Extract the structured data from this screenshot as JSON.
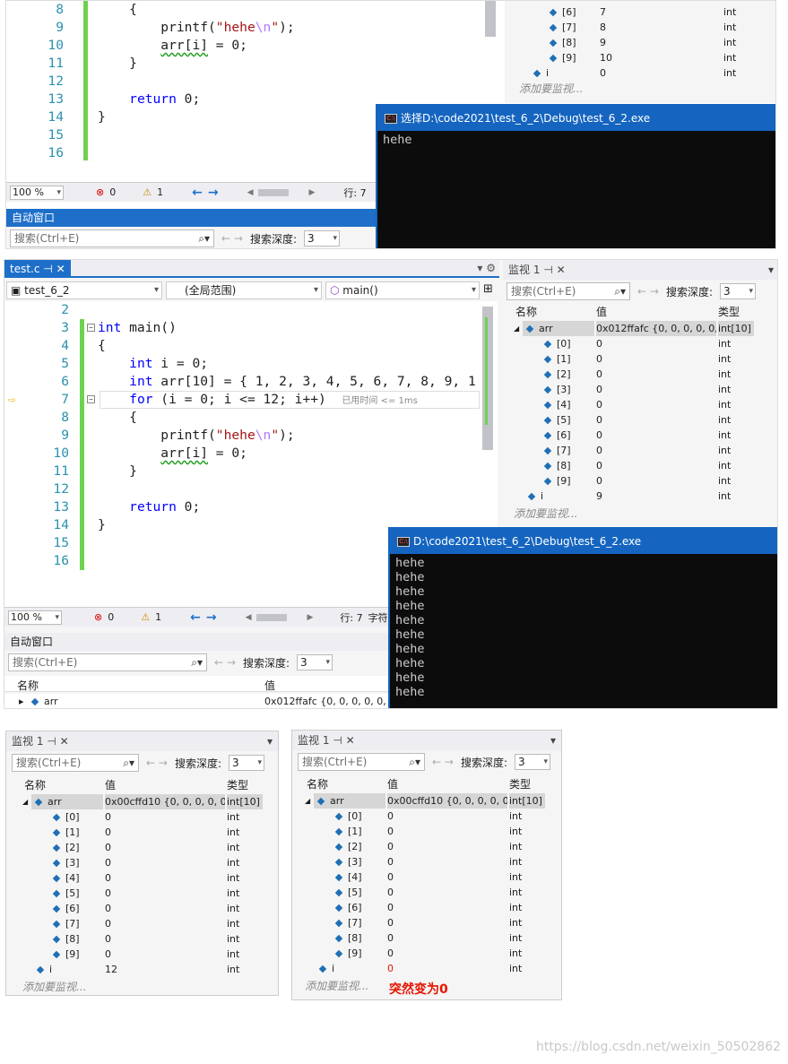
{
  "top": {
    "lines": [
      {
        "n": "8",
        "t": "{"
      },
      {
        "n": "9",
        "t": "printf(\"hehe\\n\");"
      },
      {
        "n": "10",
        "t": "arr[i] = 0;"
      },
      {
        "n": "11",
        "t": "}"
      },
      {
        "n": "12",
        "t": ""
      },
      {
        "n": "13",
        "t": "return 0;"
      },
      {
        "n": "14",
        "t": "}"
      },
      {
        "n": "15",
        "t": ""
      },
      {
        "n": "16",
        "t": ""
      }
    ],
    "status": {
      "zoom": "100 %",
      "errors": "0",
      "warnings": "1",
      "row": "行: 7"
    },
    "autos_title": "自动窗口",
    "search_placeholder": "搜索(Ctrl+E)",
    "depth_label": "搜索深度:",
    "depth_value": "3",
    "watch_rows": [
      {
        "name": "[6]",
        "value": "7",
        "type": "int"
      },
      {
        "name": "[7]",
        "value": "8",
        "type": "int"
      },
      {
        "name": "[8]",
        "value": "9",
        "type": "int"
      },
      {
        "name": "[9]",
        "value": "10",
        "type": "int"
      },
      {
        "name": "i",
        "value": "0",
        "type": "int"
      }
    ],
    "add_watch": "添加要监视...",
    "console_title": "选择D:\\code2021\\test_6_2\\Debug\\test_6_2.exe",
    "console_lines": [
      "hehe"
    ]
  },
  "mid": {
    "tab_label": "test.c",
    "project": "test_6_2",
    "scope": "(全局范围)",
    "func": "main()",
    "lines": [
      {
        "n": "2",
        "t": ""
      },
      {
        "n": "3",
        "t": "int main()"
      },
      {
        "n": "4",
        "t": "{"
      },
      {
        "n": "5",
        "t": "int i = 0;"
      },
      {
        "n": "6",
        "t": "int arr[10] = { 1, 2, 3, 4, 5, 6, 7, 8, 9, 1"
      },
      {
        "n": "7",
        "t": "for (i = 0; i <= 12; i++)"
      },
      {
        "n": "8",
        "t": "{"
      },
      {
        "n": "9",
        "t": "printf(\"hehe\\n\");"
      },
      {
        "n": "10",
        "t": "arr[i] = 0;"
      },
      {
        "n": "11",
        "t": "}"
      },
      {
        "n": "12",
        "t": ""
      },
      {
        "n": "13",
        "t": "return 0;"
      },
      {
        "n": "14",
        "t": "}"
      },
      {
        "n": "15",
        "t": ""
      },
      {
        "n": "16",
        "t": ""
      }
    ],
    "elapsed_hint": "已用时间 <= 1ms",
    "status": {
      "zoom": "100 %",
      "errors": "0",
      "warnings": "1",
      "row": "行: 7",
      "col": "字符"
    },
    "autos_title": "自动窗口",
    "search_placeholder": "搜索(Ctrl+E)",
    "depth_label": "搜索深度:",
    "depth_value": "3",
    "autos_cols": [
      "名称",
      "值"
    ],
    "autos_row": {
      "name": "arr",
      "value": "0x012ffafc {0, 0, 0, 0, 0, 0"
    },
    "console_title": "D:\\code2021\\test_6_2\\Debug\\test_6_2.exe",
    "console_lines": [
      "hehe",
      "hehe",
      "hehe",
      "hehe",
      "hehe",
      "hehe",
      "hehe",
      "hehe",
      "hehe",
      "hehe"
    ],
    "watch": {
      "title": "监视 1",
      "search_placeholder": "搜索(Ctrl+E)",
      "depth_label": "搜索深度:",
      "depth_value": "3",
      "cols": [
        "名称",
        "值",
        "类型"
      ],
      "arr": {
        "name": "arr",
        "value": "0x012ffafc {0, 0, 0, 0, 0, ...",
        "type": "int[10]"
      },
      "items": [
        {
          "name": "[0]",
          "value": "0",
          "type": "int"
        },
        {
          "name": "[1]",
          "value": "0",
          "type": "int"
        },
        {
          "name": "[2]",
          "value": "0",
          "type": "int"
        },
        {
          "name": "[3]",
          "value": "0",
          "type": "int"
        },
        {
          "name": "[4]",
          "value": "0",
          "type": "int"
        },
        {
          "name": "[5]",
          "value": "0",
          "type": "int"
        },
        {
          "name": "[6]",
          "value": "0",
          "type": "int"
        },
        {
          "name": "[7]",
          "value": "0",
          "type": "int"
        },
        {
          "name": "[8]",
          "value": "0",
          "type": "int"
        },
        {
          "name": "[9]",
          "value": "0",
          "type": "int"
        }
      ],
      "i": {
        "name": "i",
        "value": "9",
        "type": "int"
      },
      "add_watch": "添加要监视..."
    }
  },
  "bottom_left": {
    "title": "监视 1",
    "search_placeholder": "搜索(Ctrl+E)",
    "depth_label": "搜索深度:",
    "depth_value": "3",
    "cols": [
      "名称",
      "值",
      "类型"
    ],
    "arr": {
      "name": "arr",
      "value": "0x00cffd10 {0, 0, 0, 0, 0,...",
      "type": "int[10]"
    },
    "items": [
      {
        "name": "[0]",
        "value": "0",
        "type": "int"
      },
      {
        "name": "[1]",
        "value": "0",
        "type": "int"
      },
      {
        "name": "[2]",
        "value": "0",
        "type": "int"
      },
      {
        "name": "[3]",
        "value": "0",
        "type": "int"
      },
      {
        "name": "[4]",
        "value": "0",
        "type": "int"
      },
      {
        "name": "[5]",
        "value": "0",
        "type": "int"
      },
      {
        "name": "[6]",
        "value": "0",
        "type": "int"
      },
      {
        "name": "[7]",
        "value": "0",
        "type": "int"
      },
      {
        "name": "[8]",
        "value": "0",
        "type": "int"
      },
      {
        "name": "[9]",
        "value": "0",
        "type": "int"
      }
    ],
    "i": {
      "name": "i",
      "value": "12",
      "type": "int"
    },
    "add_watch": "添加要监视..."
  },
  "bottom_right": {
    "title": "监视 1",
    "search_placeholder": "搜索(Ctrl+E)",
    "depth_label": "搜索深度:",
    "depth_value": "3",
    "cols": [
      "名称",
      "值",
      "类型"
    ],
    "arr": {
      "name": "arr",
      "value": "0x00cffd10 {0, 0, 0, 0, 0,...",
      "type": "int[10]"
    },
    "items": [
      {
        "name": "[0]",
        "value": "0",
        "type": "int"
      },
      {
        "name": "[1]",
        "value": "0",
        "type": "int"
      },
      {
        "name": "[2]",
        "value": "0",
        "type": "int"
      },
      {
        "name": "[3]",
        "value": "0",
        "type": "int"
      },
      {
        "name": "[4]",
        "value": "0",
        "type": "int"
      },
      {
        "name": "[5]",
        "value": "0",
        "type": "int"
      },
      {
        "name": "[6]",
        "value": "0",
        "type": "int"
      },
      {
        "name": "[7]",
        "value": "0",
        "type": "int"
      },
      {
        "name": "[8]",
        "value": "0",
        "type": "int"
      },
      {
        "name": "[9]",
        "value": "0",
        "type": "int"
      }
    ],
    "i": {
      "name": "i",
      "value": "0",
      "type": "int"
    },
    "add_watch": "添加要监视...",
    "annotation": "突然变为0"
  },
  "watermark": "https://blog.csdn.net/weixin_50502862",
  "colors": {
    "accent": "#1e6fc9",
    "changed_value": "#e51400",
    "annotation": "#e51400",
    "green_bar": "#6fd24f"
  }
}
